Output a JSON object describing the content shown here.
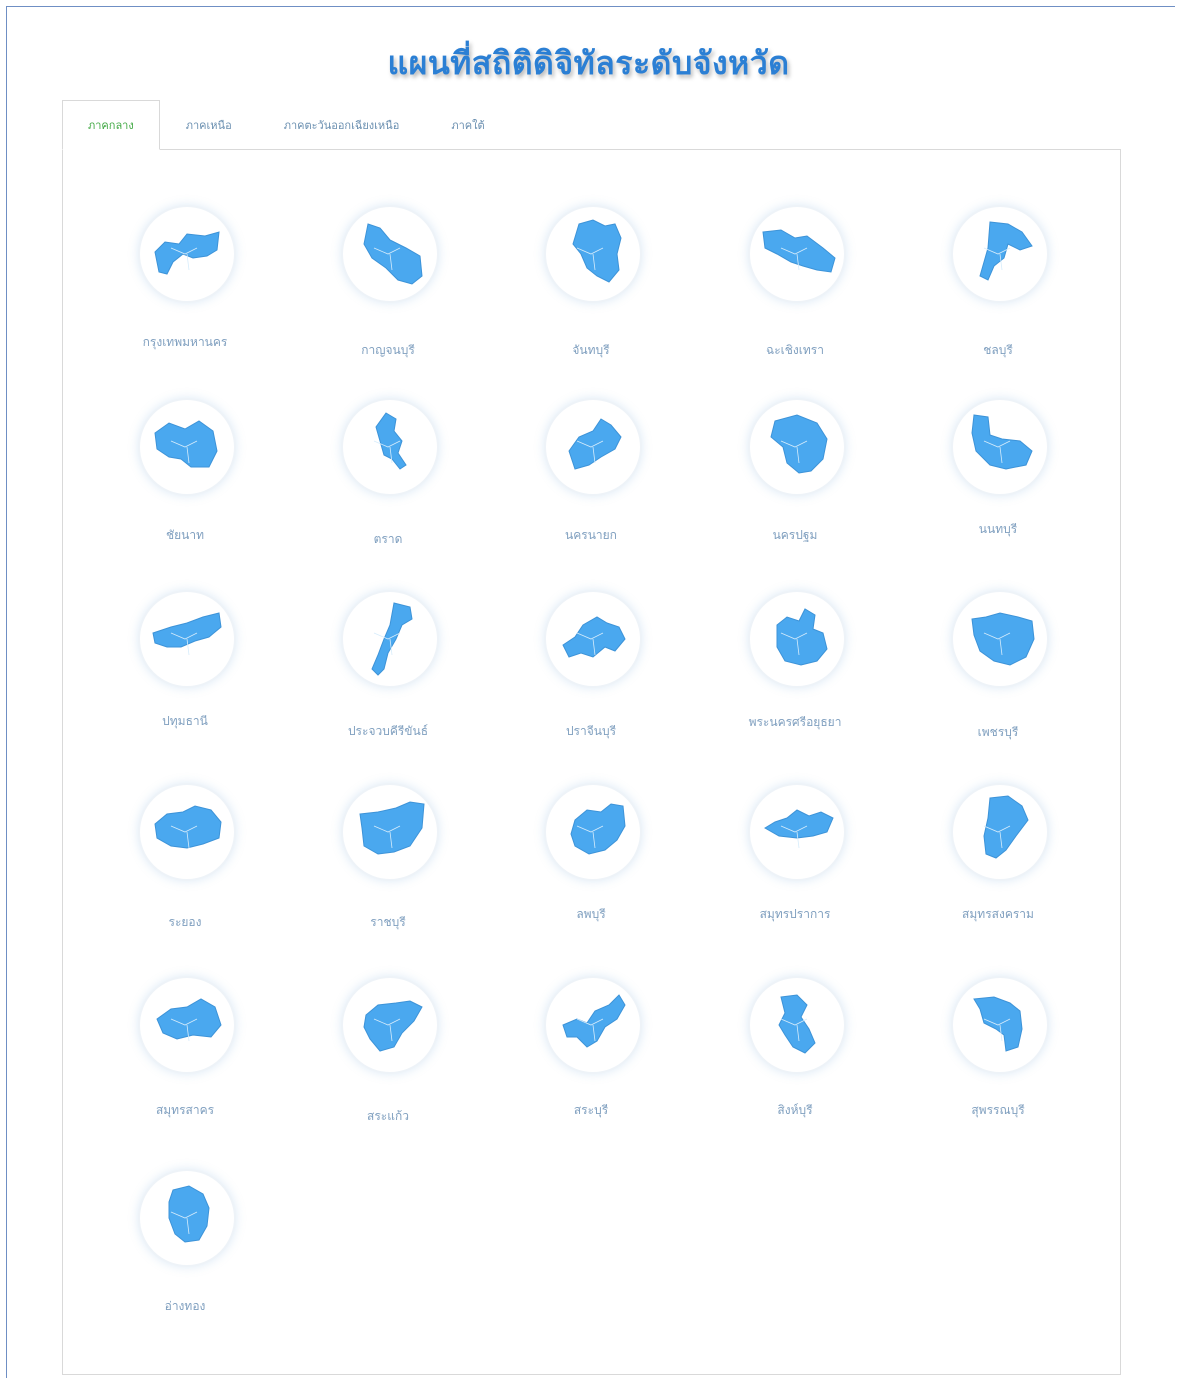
{
  "title": "แผนที่สถิติดิจิทัลระดับจังหวัด",
  "tabs": [
    {
      "label": "ภาคกลาง",
      "active": true
    },
    {
      "label": "ภาคเหนือ",
      "active": false
    },
    {
      "label": "ภาคตะวันออกเฉียงเหนือ",
      "active": false
    },
    {
      "label": "ภาคใต้",
      "active": false
    }
  ],
  "colors": {
    "accent": "#2b7fd4",
    "map_fill": "#4aa8ef",
    "active_tab": "#41a944"
  },
  "provinces": [
    {
      "name": "กรุงเทพมหานคร",
      "icon": "bangkok-map-icon"
    },
    {
      "name": "กาญจนบุรี",
      "icon": "kanchanaburi-map-icon"
    },
    {
      "name": "จันทบุรี",
      "icon": "chanthaburi-map-icon"
    },
    {
      "name": "ฉะเชิงเทรา",
      "icon": "chachoengsao-map-icon"
    },
    {
      "name": "ชลบุรี",
      "icon": "chonburi-map-icon"
    },
    {
      "name": "ชัยนาท",
      "icon": "chainat-map-icon"
    },
    {
      "name": "ตราด",
      "icon": "trat-map-icon"
    },
    {
      "name": "นครนายก",
      "icon": "nakhon-nayok-map-icon"
    },
    {
      "name": "นครปฐม",
      "icon": "nakhon-pathom-map-icon"
    },
    {
      "name": "นนทบุรี",
      "icon": "nonthaburi-map-icon"
    },
    {
      "name": "ปทุมธานี",
      "icon": "pathum-thani-map-icon"
    },
    {
      "name": "ประจวบคีรีขันธ์",
      "icon": "prachuap-map-icon"
    },
    {
      "name": "ปราจีนบุรี",
      "icon": "prachinburi-map-icon"
    },
    {
      "name": "พระนครศรีอยุธยา",
      "icon": "ayutthaya-map-icon"
    },
    {
      "name": "เพชรบุรี",
      "icon": "phetchaburi-map-icon"
    },
    {
      "name": "ระยอง",
      "icon": "rayong-map-icon"
    },
    {
      "name": "ราชบุรี",
      "icon": "ratchaburi-map-icon"
    },
    {
      "name": "ลพบุรี",
      "icon": "lopburi-map-icon"
    },
    {
      "name": "สมุทรปราการ",
      "icon": "samut-prakan-map-icon"
    },
    {
      "name": "สมุทรสงคราม",
      "icon": "samut-songkhram-map-icon"
    },
    {
      "name": "สมุทรสาคร",
      "icon": "samut-sakhon-map-icon"
    },
    {
      "name": "สระแก้ว",
      "icon": "sa-kaeo-map-icon"
    },
    {
      "name": "สระบุรี",
      "icon": "saraburi-map-icon"
    },
    {
      "name": "สิงห์บุรี",
      "icon": "singburi-map-icon"
    },
    {
      "name": "สุพรรณบุรี",
      "icon": "suphanburi-map-icon"
    },
    {
      "name": "อ่างทอง",
      "icon": "ang-thong-map-icon"
    }
  ]
}
